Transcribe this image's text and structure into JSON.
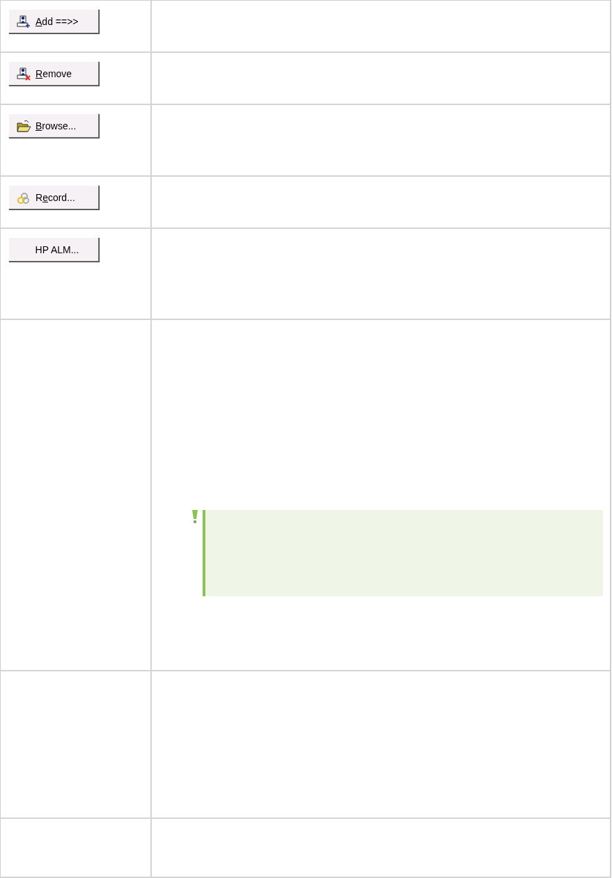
{
  "rows": [
    {
      "kind": "button",
      "button": {
        "key": "A",
        "after": "dd ==>>"
      }
    },
    {
      "kind": "button",
      "button": {
        "key": "R",
        "after": "emove"
      }
    },
    {
      "kind": "button",
      "button": {
        "key": "B",
        "after": "rowse..."
      }
    },
    {
      "kind": "button",
      "button": {
        "before": "R",
        "key": "e",
        "after": "cord..."
      }
    },
    {
      "kind": "button",
      "button": {
        "before": "HP ALM..."
      }
    },
    {
      "kind": "note"
    },
    {
      "kind": "blank"
    },
    {
      "kind": "blank"
    }
  ]
}
